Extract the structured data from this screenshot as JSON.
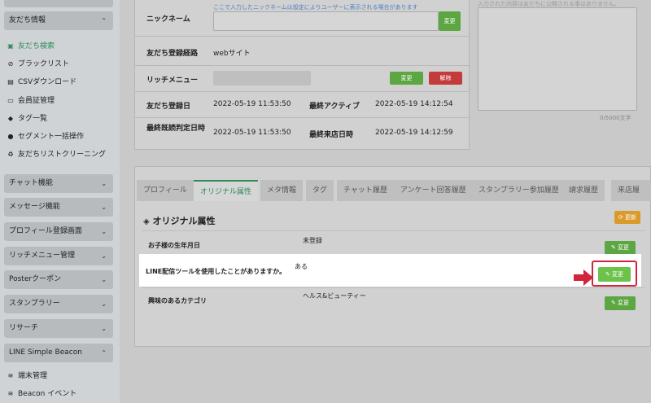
{
  "sidebar": {
    "groups": [
      {
        "label": "友だち情報"
      },
      {
        "label": "チャット機能"
      },
      {
        "label": "メッセージ機能"
      },
      {
        "label": "プロフィール登録画面"
      },
      {
        "label": "リッチメニュー管理"
      },
      {
        "label": "Posterクーポン"
      },
      {
        "label": "スタンプラリー"
      },
      {
        "label": "リサーチ"
      },
      {
        "label": "LINE Simple Beacon"
      }
    ],
    "friend_items": [
      {
        "label": "友だち検索"
      },
      {
        "label": "ブラックリスト"
      },
      {
        "label": "CSVダウンロード"
      },
      {
        "label": "会員証管理"
      },
      {
        "label": "タグ一覧"
      },
      {
        "label": "セグメント一括操作"
      },
      {
        "label": "友だちリストクリーニング"
      }
    ],
    "beacon_items": [
      {
        "label": "端末管理"
      },
      {
        "label": "Beacon イベント"
      }
    ]
  },
  "info": {
    "nickname_label": "ニックネーム",
    "nickname_hint": "ここで入力したニックネームは設定によりユーザーに表示される場合があります",
    "nickname_btn": "変更",
    "route_label": "友だち登録経路",
    "route_value": "webサイト",
    "rich_label": "リッチメニュー",
    "rich_change": "変更",
    "rich_remove": "解除",
    "reg_label": "友だち登録日",
    "reg_value": "2022-05-19 11:53:50",
    "active_label": "最終アクティブ",
    "active_value": "2022-05-19 14:12:54",
    "read_label": "最終既読判定日時",
    "read_value": "2022-05-19 11:53:50",
    "visit_label": "最終来店日時",
    "visit_value": "2022-05-19 14:12:59"
  },
  "memo": {
    "note": "入力された内容は友だちに公開される事はありません。",
    "count": "0/5000文字"
  },
  "tabs": [
    {
      "label": "プロフィール"
    },
    {
      "label": "オリジナル属性"
    },
    {
      "label": "メタ情報"
    },
    {
      "label": "タグ"
    },
    {
      "label": "チャット履歴"
    },
    {
      "label": "アンケート回答履歴"
    },
    {
      "label": "スタンプラリー参加履歴"
    },
    {
      "label": "請求履歴"
    },
    {
      "label": "来店履"
    }
  ],
  "attributes": {
    "title": "オリジナル属性",
    "refresh": "更新",
    "edit": "変更",
    "rows": [
      {
        "label": "お子様の生年月日",
        "value": "未登録"
      },
      {
        "label": "LINE配信ツールを使用したことがありますか。",
        "value": "ある"
      },
      {
        "label": "興味のあるカテゴリ",
        "value": "ヘルス&ビューティー"
      }
    ]
  },
  "colors": {
    "accent": "#2e8b57",
    "button_green": "#5da743",
    "highlight_red": "#d0253a"
  }
}
